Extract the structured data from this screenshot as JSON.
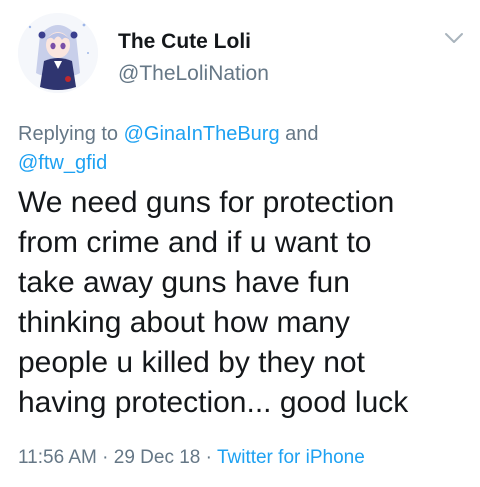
{
  "tweet": {
    "display_name": "The Cute Loli",
    "handle": "@TheLoliNation",
    "reply": {
      "prefix": "Replying to",
      "mention_1": "@GinaInTheBurg",
      "conjunction": "and",
      "mention_2": "@ftw_gfid"
    },
    "text_lines": [
      "We need guns for protection",
      "from crime and if u want to",
      "take away guns have fun",
      "thinking about how many",
      "people u killed by they not",
      "having protection... good luck"
    ],
    "time": "11:56 AM",
    "date": "29 Dec 18",
    "separator": "·",
    "source": "Twitter for iPhone",
    "menu_icon": "chevron-down-icon"
  },
  "colors": {
    "name": "#14171a",
    "secondary": "#657786",
    "link": "#1da1f2"
  }
}
